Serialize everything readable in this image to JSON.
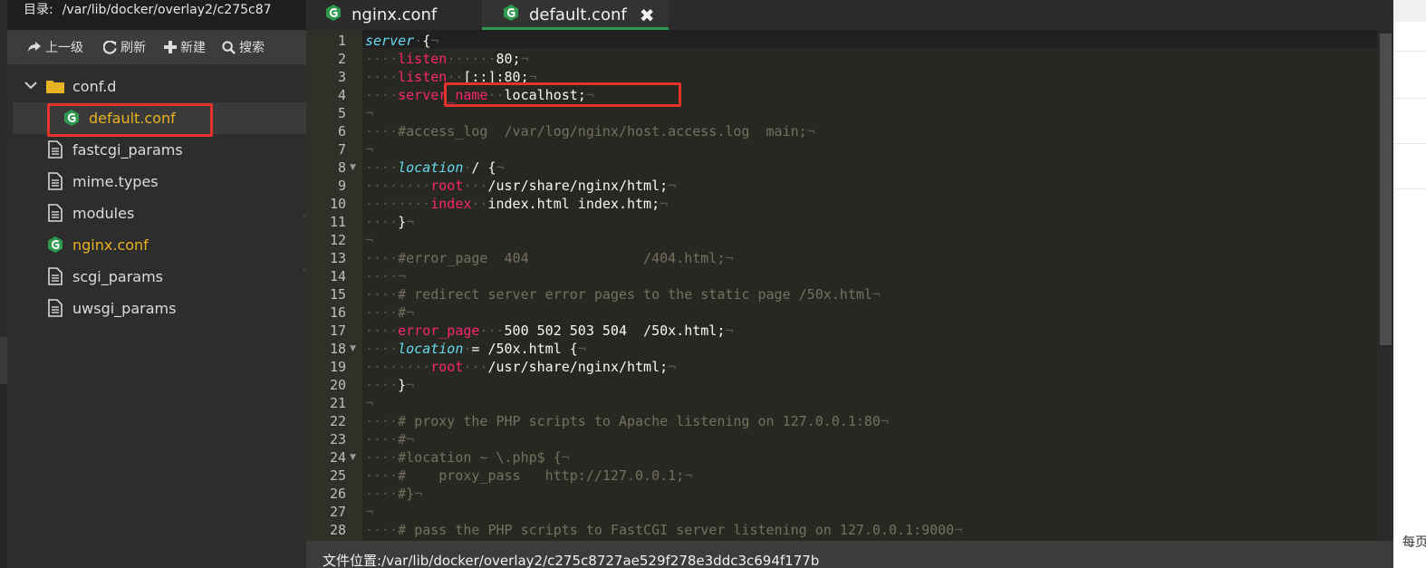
{
  "directory": {
    "label": "目录:",
    "path": "/var/lib/docker/overlay2/c275c87"
  },
  "toolbar": {
    "up": "上一级",
    "refresh": "刷新",
    "new": "新建",
    "search": "搜索"
  },
  "tree": [
    {
      "name": "conf.d",
      "type": "folder",
      "expanded": true,
      "depth": 0
    },
    {
      "name": "default.conf",
      "type": "nginx",
      "depth": 1,
      "selected": true
    },
    {
      "name": "fastcgi_params",
      "type": "file",
      "depth": 0
    },
    {
      "name": "mime.types",
      "type": "file",
      "depth": 0
    },
    {
      "name": "modules",
      "type": "file",
      "depth": 0
    },
    {
      "name": "nginx.conf",
      "type": "nginx",
      "depth": 0
    },
    {
      "name": "scgi_params",
      "type": "file",
      "depth": 0
    },
    {
      "name": "uwsgi_params",
      "type": "file",
      "depth": 0
    }
  ],
  "tabs": [
    {
      "label": "nginx.conf",
      "active": false
    },
    {
      "label": "default.conf",
      "active": true,
      "close": "✖"
    }
  ],
  "editor": {
    "lines": [
      "1",
      "2",
      "3",
      "4",
      "5",
      "6",
      "7",
      "8",
      "9",
      "10",
      "11",
      "12",
      "13",
      "14",
      "15",
      "16",
      "17",
      "18",
      "19",
      "20",
      "21",
      "22",
      "23",
      "24",
      "25",
      "26",
      "27",
      "28"
    ],
    "code": {
      "l1a": "server",
      "l1b": "{",
      "l2a": "listen",
      "l2b": "80;",
      "l3a": "listen",
      "l3b": "[::]:80;",
      "l4a": "server_name",
      "l4b": "localhost;",
      "l6": "#access_log  /var/log/nginx/host.access.log  main;",
      "l8a": "location",
      "l8b": "/ {",
      "l9a": "root",
      "l9b": "/usr/share/nginx/html;",
      "l10a": "index",
      "l10b": "index.html index.htm;",
      "l11": "}",
      "l13": "#error_page  404              /404.html;",
      "l15": "# redirect server error pages to the static page /50x.html",
      "l16": "#",
      "l17a": "error_page",
      "l17b": "500 502 503 504  /50x.html;",
      "l18a": "location",
      "l18b": "= /50x.html {",
      "l19a": "root",
      "l19b": "/usr/share/nginx/html;",
      "l20": "}",
      "l22": "# proxy the PHP scripts to Apache listening on 127.0.0.1:80",
      "l23": "#",
      "l24": "#location ~ \\.php$ {",
      "l25": "#    proxy_pass   http://127.0.0.1;",
      "l26": "#}",
      "l28": "# pass the PHP scripts to FastCGI server listening on 127.0.0.1:9000"
    }
  },
  "status": {
    "label": "文件位置:",
    "path": "/var/lib/docker/overlay2/c275c8727ae529f278e3ddc3c694f177b"
  },
  "right_strip": {
    "text": "每页"
  },
  "colors": {
    "accent": "#2e9a4d",
    "highlight": "#e5322b",
    "nginx_file": "#e8b320"
  }
}
